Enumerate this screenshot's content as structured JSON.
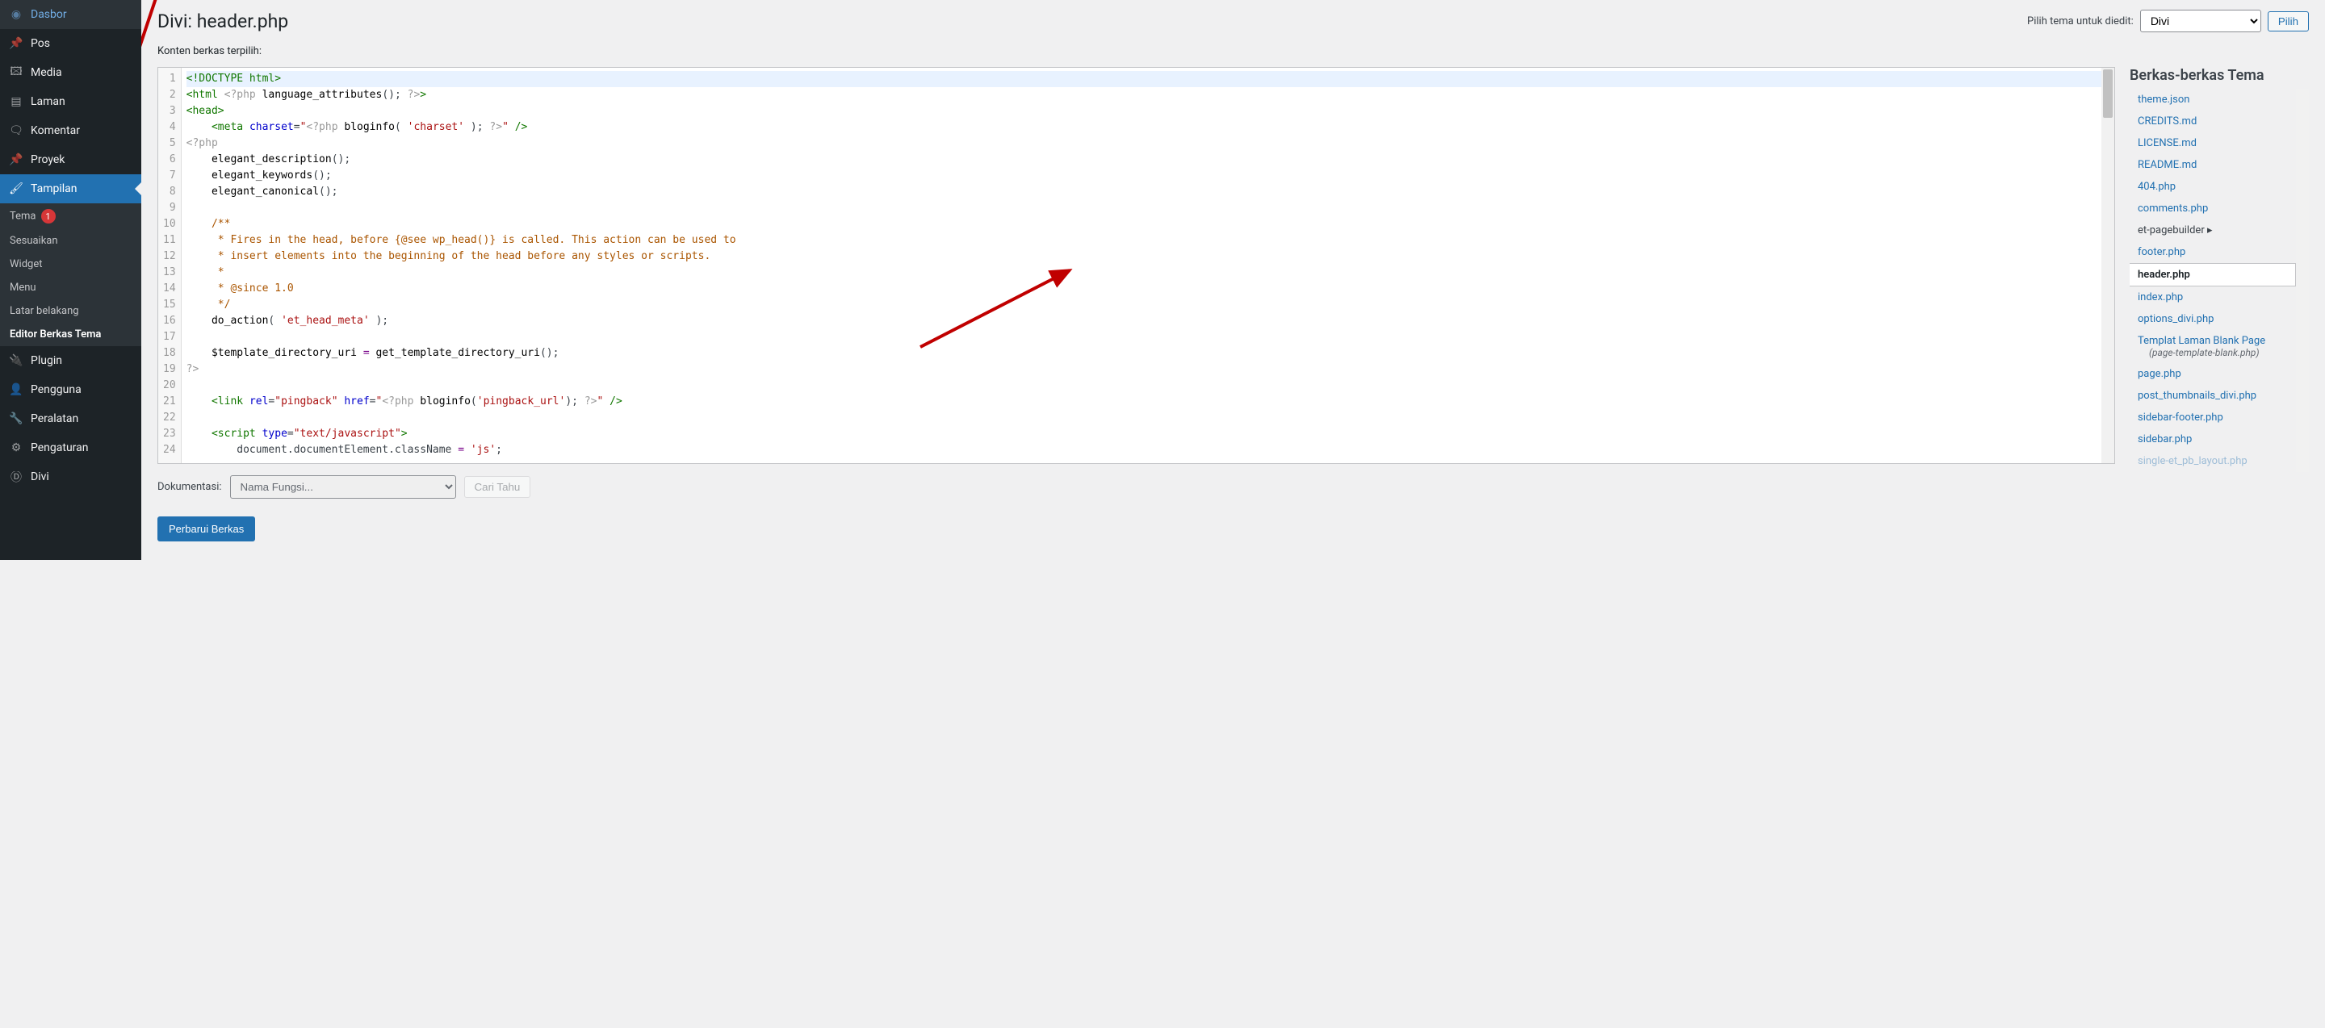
{
  "sidebar": {
    "items": [
      {
        "label": "Dasbor",
        "icon": "dashboard"
      },
      {
        "label": "Pos",
        "icon": "pin"
      },
      {
        "label": "Media",
        "icon": "media"
      },
      {
        "label": "Laman",
        "icon": "page"
      },
      {
        "label": "Komentar",
        "icon": "comment"
      },
      {
        "label": "Proyek",
        "icon": "pin"
      },
      {
        "label": "Tampilan",
        "icon": "brush",
        "active": true
      },
      {
        "label": "Plugin",
        "icon": "plugin"
      },
      {
        "label": "Pengguna",
        "icon": "user"
      },
      {
        "label": "Peralatan",
        "icon": "wrench"
      },
      {
        "label": "Pengaturan",
        "icon": "settings"
      },
      {
        "label": "Divi",
        "icon": "divi"
      }
    ],
    "submenu": [
      {
        "label": "Tema",
        "badge": "1"
      },
      {
        "label": "Sesuaikan"
      },
      {
        "label": "Widget"
      },
      {
        "label": "Menu"
      },
      {
        "label": "Latar belakang"
      },
      {
        "label": "Editor Berkas Tema",
        "current": true
      }
    ]
  },
  "header": {
    "title": "Divi: header.php",
    "select_label": "Pilih tema untuk diedit:",
    "select_value": "Divi",
    "select_button": "Pilih"
  },
  "subheading": "Konten berkas terpilih:",
  "files": {
    "title": "Berkas-berkas Tema",
    "items": [
      {
        "label": "theme.json"
      },
      {
        "label": "CREDITS.md"
      },
      {
        "label": "LICENSE.md"
      },
      {
        "label": "README.md"
      },
      {
        "label": "404.php"
      },
      {
        "label": "comments.php"
      },
      {
        "label": "et-pagebuilder",
        "folder": true
      },
      {
        "label": "footer.php"
      },
      {
        "label": "header.php",
        "active": true
      },
      {
        "label": "index.php"
      },
      {
        "label": "options_divi.php"
      },
      {
        "label": "Templat Laman Blank Page",
        "sub": "(page-template-blank.php)"
      },
      {
        "label": "page.php"
      },
      {
        "label": "post_thumbnails_divi.php"
      },
      {
        "label": "sidebar-footer.php"
      },
      {
        "label": "sidebar.php"
      },
      {
        "label": "single-et_pb_layout.php",
        "cut": true
      }
    ]
  },
  "code": {
    "lines": [
      1,
      2,
      3,
      4,
      5,
      6,
      7,
      8,
      9,
      10,
      11,
      12,
      13,
      14,
      15,
      16,
      17,
      18,
      19,
      20,
      21,
      22,
      23,
      24
    ]
  },
  "doc": {
    "label": "Dokumentasi:",
    "select_placeholder": "Nama Fungsi...",
    "button": "Cari Tahu"
  },
  "update_button": "Perbarui Berkas"
}
